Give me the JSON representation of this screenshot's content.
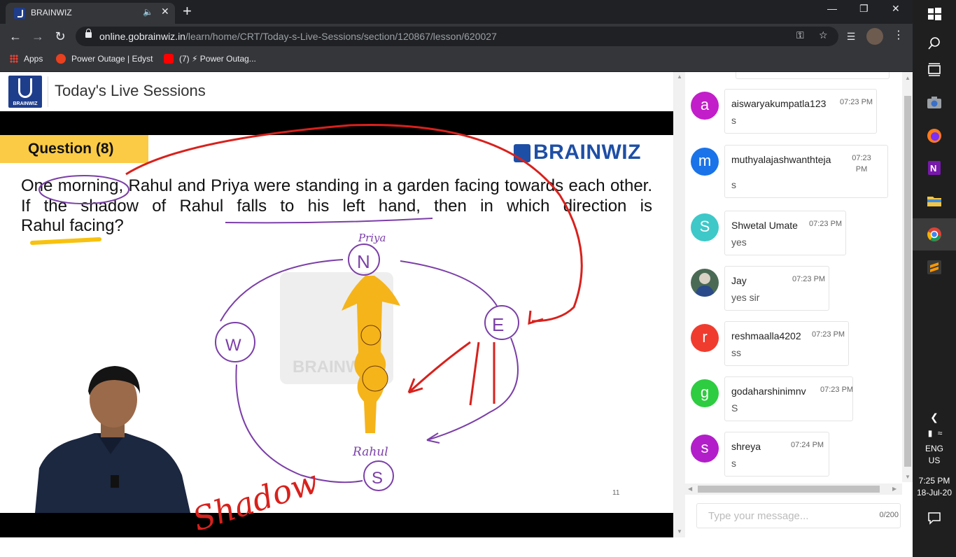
{
  "browser": {
    "tab_title": "BRAINWIZ",
    "tab_audio_icon": "speaker-icon",
    "tab_close": "✕",
    "new_tab": "+",
    "win_minimize": "—",
    "win_restore": "❐",
    "win_close": "✕",
    "url_host": "online.gobrainwiz.in",
    "url_path": "/learn/home/CRT/Today-s-Live-Sessions/section/120867/lesson/620027",
    "bookmarks": {
      "apps": "Apps",
      "b1": "Power Outage | Edyst",
      "b2": "(7) ⚡ Power Outag..."
    }
  },
  "header": {
    "logo_text": "BRAINWIZ",
    "title": "Today's Live Sessions"
  },
  "slide": {
    "question_label": "Question (8)",
    "brand": "BRAINWIZ",
    "question_line1": "One morning, Rahul and Priya were standing in a garden facing towards each",
    "question_line2": "other. If the shadow of Rahul falls to his left hand, then in which direction is",
    "question_line3": "Rahul facing?",
    "slide_number": "11",
    "watermark": "BRAINWIZ",
    "ink": {
      "priya": "Priya",
      "north": "N",
      "east": "E",
      "west": "W",
      "south": "S",
      "rahul": "Rahul",
      "shadow": "Shadow"
    }
  },
  "chat": {
    "messages": [
      {
        "initial": "a",
        "user": "aiswaryakumpatla123",
        "time": "07:23 PM",
        "text": "s",
        "color": "#c21ec9"
      },
      {
        "initial": "m",
        "user": "muthyalajashwanthteja",
        "time": "07:23 PM",
        "text": "s",
        "color": "#1a73e8"
      },
      {
        "initial": "S",
        "user": "Shwetal Umate",
        "time": "07:23 PM",
        "text": "yes",
        "color": "#3ec8c8"
      },
      {
        "initial": "",
        "user": "Jay",
        "time": "07:23 PM",
        "text": "yes sir",
        "color": "#4a6a55"
      },
      {
        "initial": "r",
        "user": "reshmaalla4202",
        "time": "07:23 PM",
        "text": "ss",
        "color": "#f03c2e"
      },
      {
        "initial": "g",
        "user": "godaharshinimnv",
        "time": "07:23 PM",
        "text": "S",
        "color": "#2ecc40"
      },
      {
        "initial": "s",
        "user": "shreya",
        "time": "07:24 PM",
        "text": "s",
        "color": "#b21ec9"
      }
    ],
    "input_placeholder": "Type your message...",
    "counter": "0/200"
  },
  "taskbar": {
    "lang1": "ENG",
    "lang2": "US",
    "time": "7:25 PM",
    "date": "18-Jul-20"
  }
}
